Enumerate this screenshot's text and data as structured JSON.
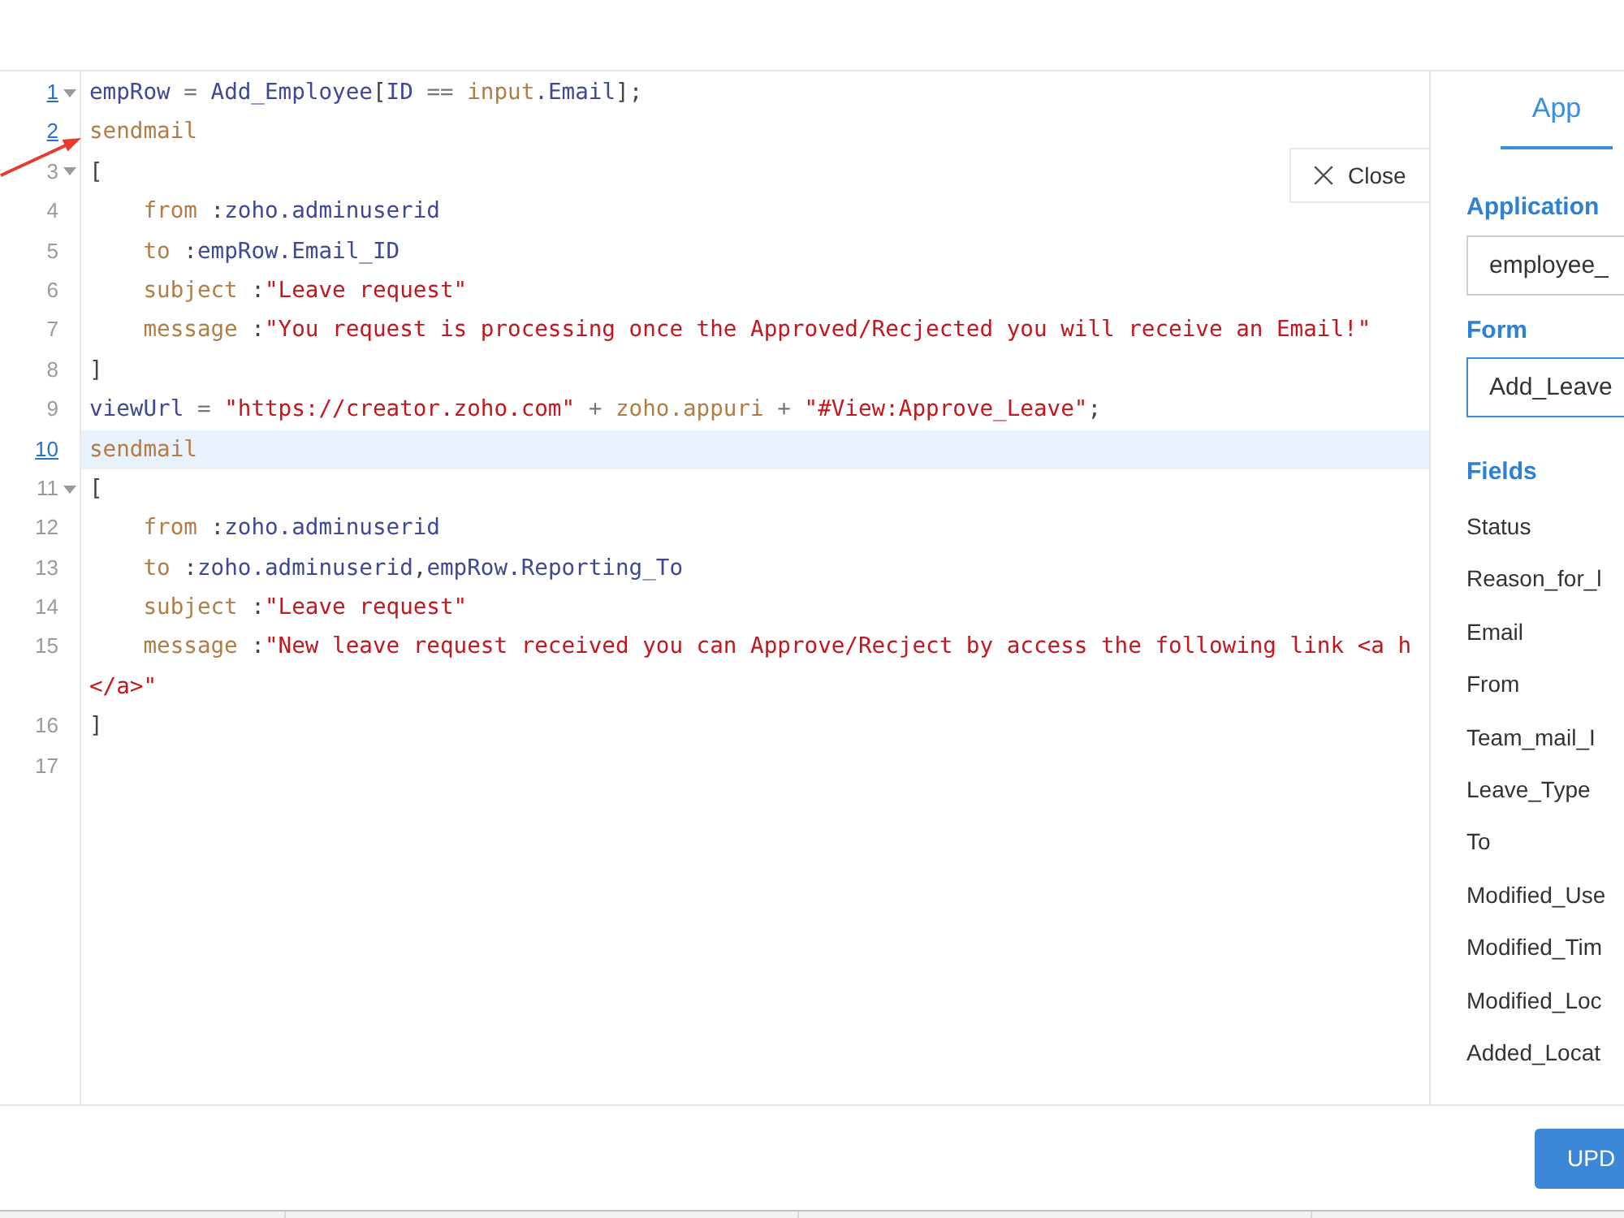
{
  "editor": {
    "lines": [
      {
        "number": "1",
        "linked": true,
        "foldable": true,
        "active": false,
        "indented": false,
        "tokens": [
          {
            "kind": "ident",
            "text": "empRow"
          },
          {
            "kind": "op",
            "text": " = "
          },
          {
            "kind": "ident",
            "text": "Add_Employee"
          },
          {
            "kind": "punct",
            "text": "["
          },
          {
            "kind": "ident",
            "text": "ID"
          },
          {
            "kind": "op",
            "text": " == "
          },
          {
            "kind": "keyword",
            "text": "input"
          },
          {
            "kind": "ident",
            "text": ".Email"
          },
          {
            "kind": "punct",
            "text": "];"
          }
        ]
      },
      {
        "number": "2",
        "linked": true,
        "foldable": false,
        "active": false,
        "indented": false,
        "tokens": [
          {
            "kind": "keyword",
            "text": "sendmail"
          }
        ]
      },
      {
        "number": "3",
        "linked": false,
        "foldable": true,
        "active": false,
        "indented": false,
        "tokens": [
          {
            "kind": "punct",
            "text": "["
          }
        ]
      },
      {
        "number": "4",
        "linked": false,
        "foldable": false,
        "active": false,
        "indented": true,
        "tokens": [
          {
            "kind": "keyword",
            "text": "from"
          },
          {
            "kind": "punct",
            "text": " :"
          },
          {
            "kind": "ident",
            "text": "zoho.adminuserid"
          }
        ]
      },
      {
        "number": "5",
        "linked": false,
        "foldable": false,
        "active": false,
        "indented": true,
        "tokens": [
          {
            "kind": "keyword",
            "text": "to"
          },
          {
            "kind": "punct",
            "text": " :"
          },
          {
            "kind": "ident",
            "text": "empRow.Email_ID"
          }
        ]
      },
      {
        "number": "6",
        "linked": false,
        "foldable": false,
        "active": false,
        "indented": true,
        "tokens": [
          {
            "kind": "keyword",
            "text": "subject"
          },
          {
            "kind": "punct",
            "text": " :"
          },
          {
            "kind": "string",
            "text": "\"Leave request\""
          }
        ]
      },
      {
        "number": "7",
        "linked": false,
        "foldable": false,
        "active": false,
        "indented": true,
        "tokens": [
          {
            "kind": "keyword",
            "text": "message"
          },
          {
            "kind": "punct",
            "text": " :"
          },
          {
            "kind": "string",
            "text": "\"You request is processing once the Approved/Recjected you will receive an Email!\""
          }
        ]
      },
      {
        "number": "8",
        "linked": false,
        "foldable": false,
        "active": false,
        "indented": false,
        "tokens": [
          {
            "kind": "punct",
            "text": "]"
          }
        ]
      },
      {
        "number": "9",
        "linked": false,
        "foldable": false,
        "active": false,
        "indented": false,
        "tokens": [
          {
            "kind": "ident",
            "text": "viewUrl"
          },
          {
            "kind": "op",
            "text": " = "
          },
          {
            "kind": "string",
            "text": "\"https://creator.zoho.com\""
          },
          {
            "kind": "op",
            "text": " + "
          },
          {
            "kind": "keyword",
            "text": "zoho.appuri"
          },
          {
            "kind": "op",
            "text": " + "
          },
          {
            "kind": "string",
            "text": "\"#View:Approve_Leave\""
          },
          {
            "kind": "punct",
            "text": ";"
          }
        ]
      },
      {
        "number": "10",
        "linked": true,
        "foldable": false,
        "active": true,
        "indented": false,
        "tokens": [
          {
            "kind": "keyword",
            "text": "sendmail"
          }
        ]
      },
      {
        "number": "11",
        "linked": false,
        "foldable": true,
        "active": false,
        "indented": false,
        "tokens": [
          {
            "kind": "punct",
            "text": "["
          }
        ]
      },
      {
        "number": "12",
        "linked": false,
        "foldable": false,
        "active": false,
        "indented": true,
        "tokens": [
          {
            "kind": "keyword",
            "text": "from"
          },
          {
            "kind": "punct",
            "text": " :"
          },
          {
            "kind": "ident",
            "text": "zoho.adminuserid"
          }
        ]
      },
      {
        "number": "13",
        "linked": false,
        "foldable": false,
        "active": false,
        "indented": true,
        "tokens": [
          {
            "kind": "keyword",
            "text": "to"
          },
          {
            "kind": "punct",
            "text": " :"
          },
          {
            "kind": "ident",
            "text": "zoho.adminuserid"
          },
          {
            "kind": "punct",
            "text": ","
          },
          {
            "kind": "ident",
            "text": "empRow.Reporting_To"
          }
        ]
      },
      {
        "number": "14",
        "linked": false,
        "foldable": false,
        "active": false,
        "indented": true,
        "tokens": [
          {
            "kind": "keyword",
            "text": "subject"
          },
          {
            "kind": "punct",
            "text": " :"
          },
          {
            "kind": "string",
            "text": "\"Leave request\""
          }
        ]
      },
      {
        "number": "15",
        "linked": false,
        "foldable": false,
        "active": false,
        "indented": true,
        "tokens": [
          {
            "kind": "keyword",
            "text": "message"
          },
          {
            "kind": "punct",
            "text": " :"
          },
          {
            "kind": "string",
            "text": "\"New leave request received you can Approve/Recject by access the following link <a h"
          }
        ],
        "wrap_tokens": [
          {
            "kind": "string",
            "text": "</a>\""
          }
        ]
      },
      {
        "number": "16",
        "linked": false,
        "foldable": false,
        "active": false,
        "indented": false,
        "tokens": [
          {
            "kind": "punct",
            "text": "]"
          }
        ]
      },
      {
        "number": "17",
        "linked": false,
        "foldable": false,
        "active": false
      }
    ],
    "close_button": {
      "label": "Close"
    }
  },
  "side_panel": {
    "tabs": [
      {
        "label": "App",
        "selected": true
      }
    ],
    "application": {
      "label": "Application",
      "value": "employee_",
      "focused": false
    },
    "form": {
      "label": "Form",
      "value": "Add_Leave",
      "focused": true
    },
    "fields": {
      "heading": "Fields",
      "items": [
        "Status",
        "Reason_for_l",
        "Email",
        "From",
        "Team_mail_I",
        "Leave_Type",
        "To",
        "Modified_Use",
        "Modified_Tim",
        "Modified_Loc",
        "Added_Locat"
      ]
    }
  },
  "footer": {
    "buttons": [
      {
        "label": "UPD"
      }
    ]
  }
}
